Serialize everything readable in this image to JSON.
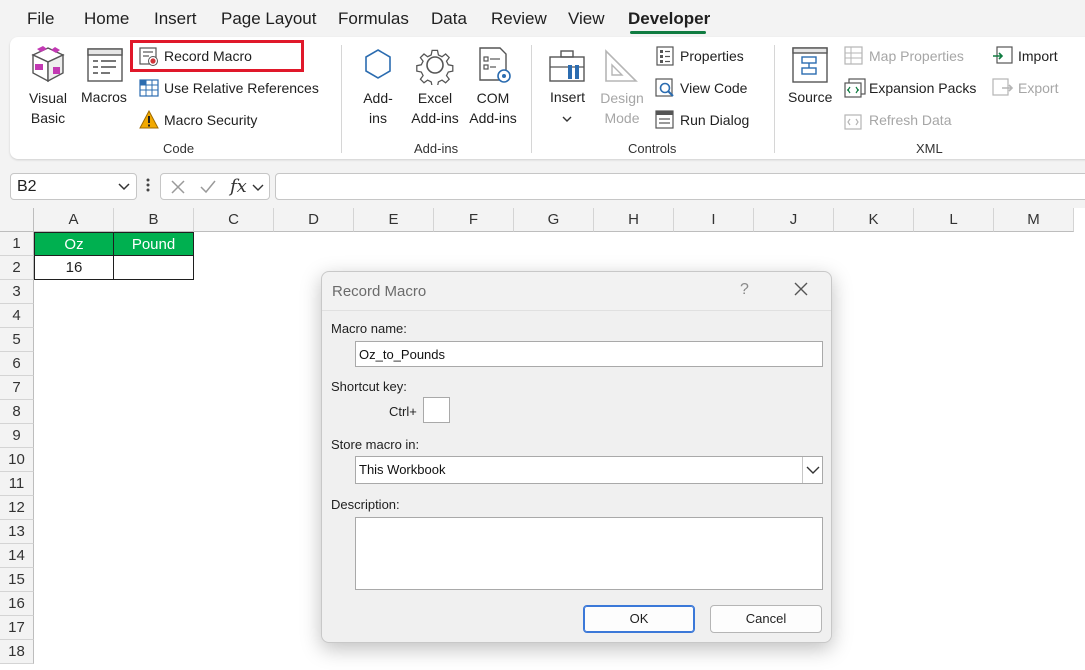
{
  "menu": {
    "tabs": [
      "File",
      "Home",
      "Insert",
      "Page Layout",
      "Formulas",
      "Data",
      "Review",
      "View",
      "Developer"
    ],
    "active": "Developer"
  },
  "ribbon": {
    "code": {
      "group_label": "Code",
      "visual_basic": [
        "Visual",
        "Basic"
      ],
      "macros": "Macros",
      "record_macro": "Record Macro",
      "use_relative": "Use Relative References",
      "macro_security": "Macro Security"
    },
    "addins": {
      "group_label": "Add-ins",
      "addins": [
        "Add-",
        "ins"
      ],
      "excel_addins": [
        "Excel",
        "Add-ins"
      ],
      "com_addins": [
        "COM",
        "Add-ins"
      ]
    },
    "controls": {
      "group_label": "Controls",
      "insert": "Insert",
      "design_mode": [
        "Design",
        "Mode"
      ],
      "properties": "Properties",
      "view_code": "View Code",
      "run_dialog": "Run Dialog"
    },
    "xml": {
      "group_label": "XML",
      "source": "Source",
      "map_properties": "Map Properties",
      "expansion_packs": "Expansion Packs",
      "refresh_data": "Refresh Data",
      "import": "Import",
      "export": "Export"
    }
  },
  "formula_bar": {
    "name_box": "B2",
    "fx": "fx",
    "formula": ""
  },
  "sheet": {
    "columns": [
      "A",
      "B",
      "C",
      "D",
      "E",
      "F",
      "G",
      "H",
      "I",
      "J",
      "K",
      "L",
      "M"
    ],
    "rows": [
      "1",
      "2",
      "3",
      "4",
      "5",
      "6",
      "7",
      "8",
      "9",
      "10",
      "11",
      "12",
      "13",
      "14",
      "15",
      "16",
      "17",
      "18"
    ],
    "header_cells": [
      "Oz",
      "Pound"
    ],
    "value_cells": [
      "16",
      ""
    ]
  },
  "dialog": {
    "title": "Record Macro",
    "help": "?",
    "macro_name_label": "Macro name:",
    "macro_name_value": "Oz_to_Pounds",
    "shortcut_label": "Shortcut key:",
    "ctrl_label": "Ctrl+",
    "shortcut_value": "",
    "store_label": "Store macro in:",
    "store_value": "This Workbook",
    "description_label": "Description:",
    "description_value": "",
    "ok": "OK",
    "cancel": "Cancel"
  },
  "colors": {
    "accent": "#107c41",
    "highlight": "#e0182a",
    "header_fill": "#00b050"
  }
}
